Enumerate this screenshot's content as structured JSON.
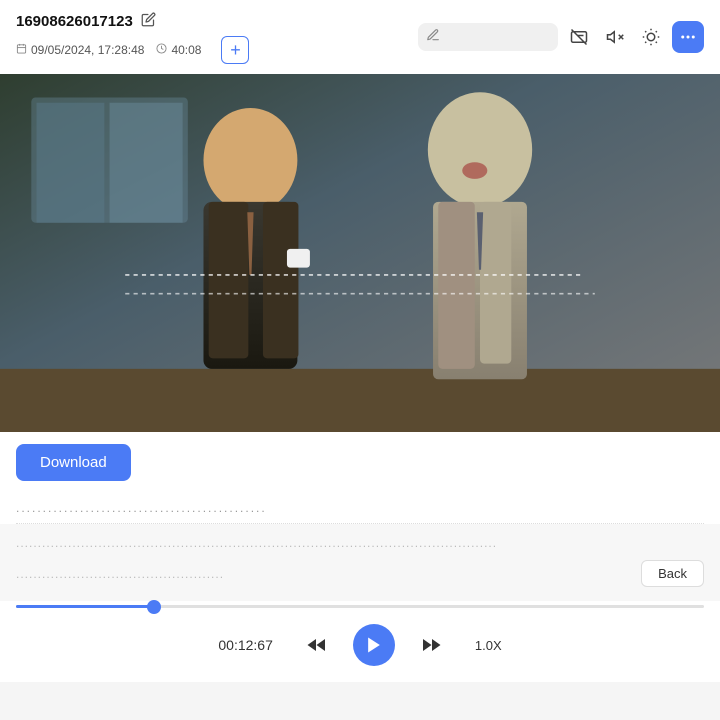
{
  "header": {
    "id": "16908626017123",
    "date": "09/05/2024, 17:28:48",
    "duration": "40:08",
    "add_label": "+",
    "edit_icon": "✏"
  },
  "toolbar": {
    "search_placeholder": "",
    "pencil_icon": "pencil",
    "no_subtitle_icon": "no-subtitle",
    "no_audio_icon": "no-audio",
    "brightness_icon": "brightness",
    "more_icon": "more"
  },
  "video": {
    "dotted_line_1": ".................................",
    "dotted_line_2": "..................................................................................................."
  },
  "action_bar": {
    "download_label": "Download"
  },
  "info": {
    "row1": "...............................................",
    "row2": "...............................................................................................................",
    "row3": "................................................"
  },
  "player": {
    "time": "00:12:67",
    "speed": "1.0X",
    "back_label": "Back"
  },
  "progress": {
    "fill_percent": 20
  }
}
